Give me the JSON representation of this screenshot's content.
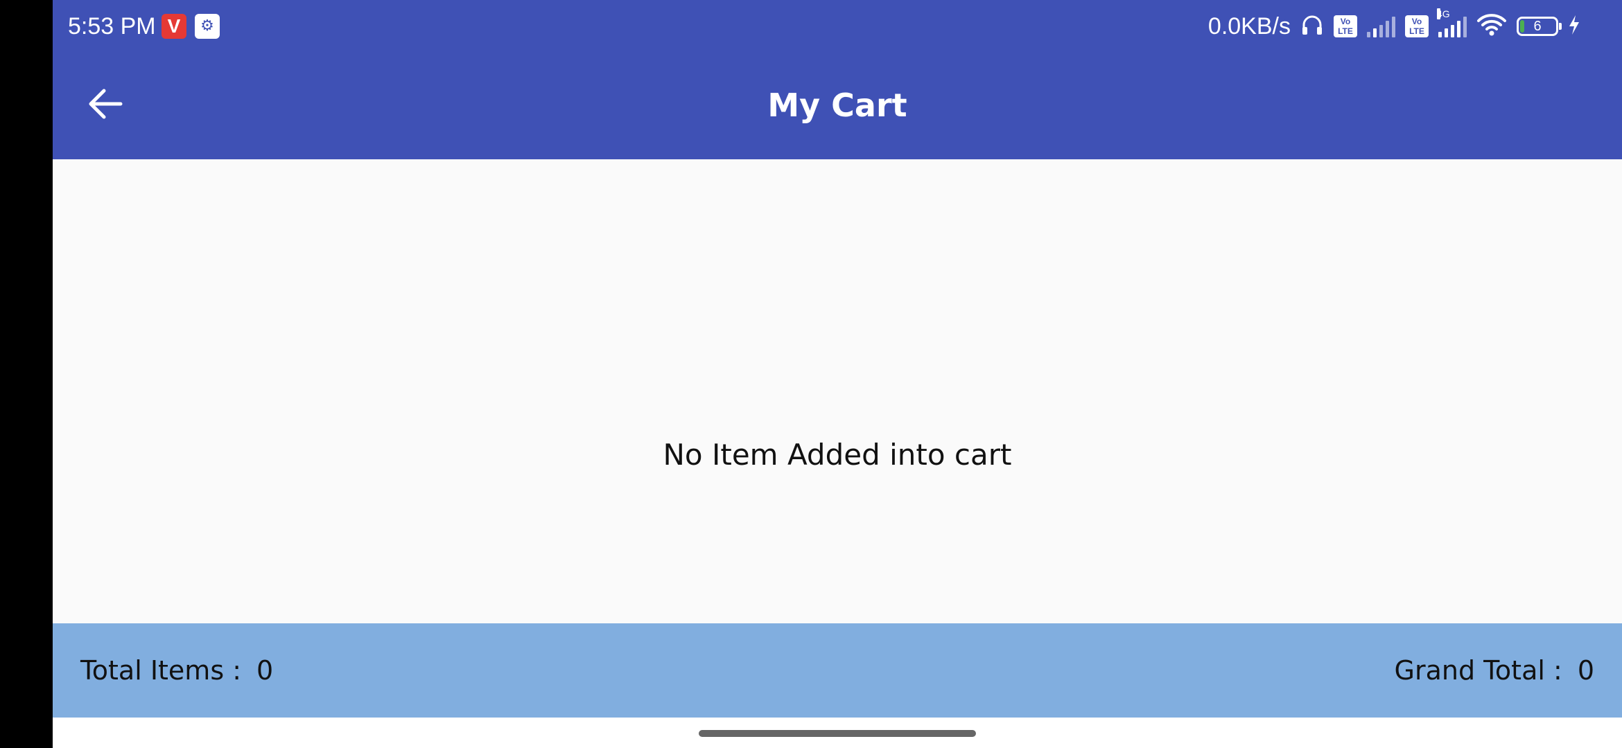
{
  "status_bar": {
    "time": "5:53 PM",
    "app_icon_letter": "V",
    "net_speed": "0.0KB/s",
    "volte_label": "Vo LTE",
    "net_type": "4G",
    "battery_level": "6",
    "icons": [
      "headphones-icon",
      "volte-icon",
      "signal-icon",
      "wifi-icon",
      "battery-icon",
      "charging-icon"
    ]
  },
  "app_bar": {
    "title": "My Cart",
    "back_icon": "arrow-left-icon"
  },
  "content": {
    "empty_message": "No Item Added into cart"
  },
  "footer": {
    "total_items_label": "Total Items :",
    "total_items_value": "0",
    "grand_total_label": "Grand Total :",
    "grand_total_value": "0"
  },
  "colors": {
    "primary": "#3f51b5",
    "footer_bg": "#81aedf",
    "content_bg": "#fafafa"
  }
}
